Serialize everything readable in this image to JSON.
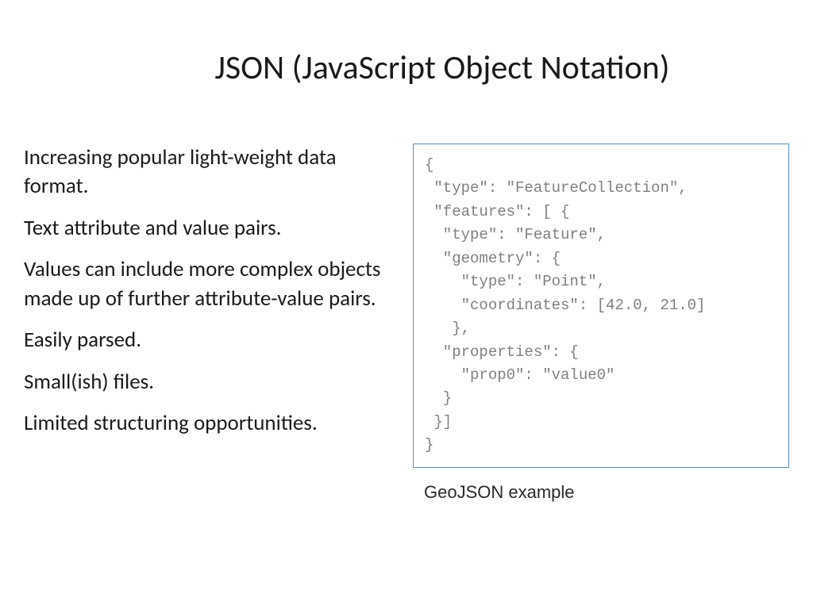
{
  "title": "JSON (JavaScript Object Notation)",
  "bullets": {
    "b0": "Increasing popular light-weight data format.",
    "b1": "Text attribute and value pairs.",
    "b2": "Values can include more complex objects made up of further attribute-value pairs.",
    "b3": "Easily parsed.",
    "b4": "Small(ish) files.",
    "b5": "Limited structuring opportunities."
  },
  "code": "{\n \"type\": \"FeatureCollection\",\n \"features\": [ {\n  \"type\": \"Feature\",\n  \"geometry\": {\n    \"type\": \"Point\",\n    \"coordinates\": [42.0, 21.0]\n   },\n  \"properties\": {\n    \"prop0\": \"value0\"\n  }\n }]\n}",
  "caption": "GeoJSON example"
}
